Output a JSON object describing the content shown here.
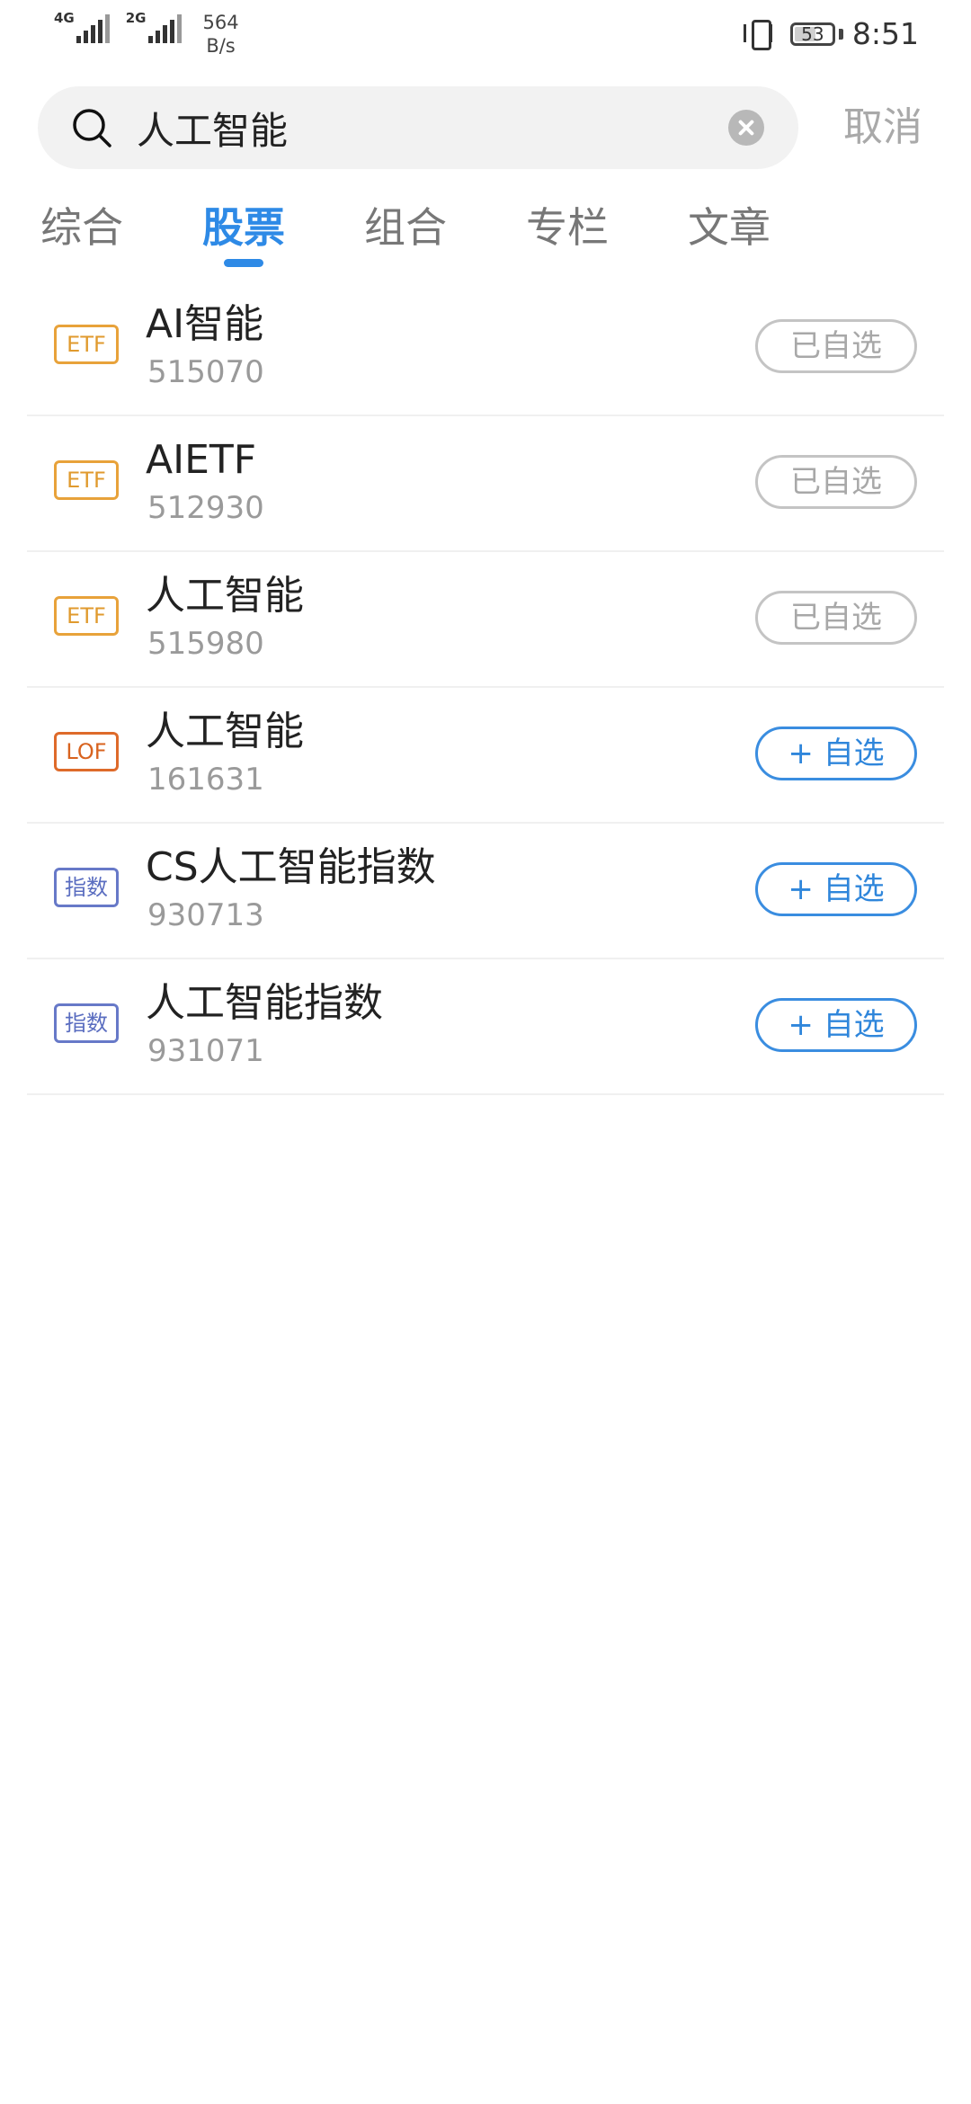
{
  "status_bar": {
    "network_1": "4G",
    "network_2": "2G",
    "speed_value": "564",
    "speed_unit": "B/s",
    "battery": "53",
    "time": "8:51"
  },
  "search": {
    "value": "人工智能",
    "cancel_label": "取消"
  },
  "tabs": [
    {
      "label": "综合",
      "active": false
    },
    {
      "label": "股票",
      "active": true
    },
    {
      "label": "组合",
      "active": false
    },
    {
      "label": "专栏",
      "active": false
    },
    {
      "label": "文章",
      "active": false
    }
  ],
  "results": [
    {
      "badge": "ETF",
      "badge_type": "etf",
      "name": "AI智能",
      "code": "515070",
      "button": "已自选",
      "button_state": "added"
    },
    {
      "badge": "ETF",
      "badge_type": "etf",
      "name": "AIETF",
      "code": "512930",
      "button": "已自选",
      "button_state": "added"
    },
    {
      "badge": "ETF",
      "badge_type": "etf",
      "name": "人工智能",
      "code": "515980",
      "button": "已自选",
      "button_state": "added"
    },
    {
      "badge": "LOF",
      "badge_type": "lof",
      "name": "人工智能",
      "code": "161631",
      "button": "+ 自选",
      "button_state": "add"
    },
    {
      "badge": "指数",
      "badge_type": "index",
      "name": "CS人工智能指数",
      "code": "930713",
      "button": "+ 自选",
      "button_state": "add"
    },
    {
      "badge": "指数",
      "badge_type": "index",
      "name": "人工智能指数",
      "code": "931071",
      "button": "+ 自选",
      "button_state": "add"
    }
  ],
  "colors": {
    "accent": "#2e8ae6",
    "etf_badge": "#e8a23a",
    "lof_badge": "#de6a2a",
    "index_badge": "#6779c8"
  }
}
